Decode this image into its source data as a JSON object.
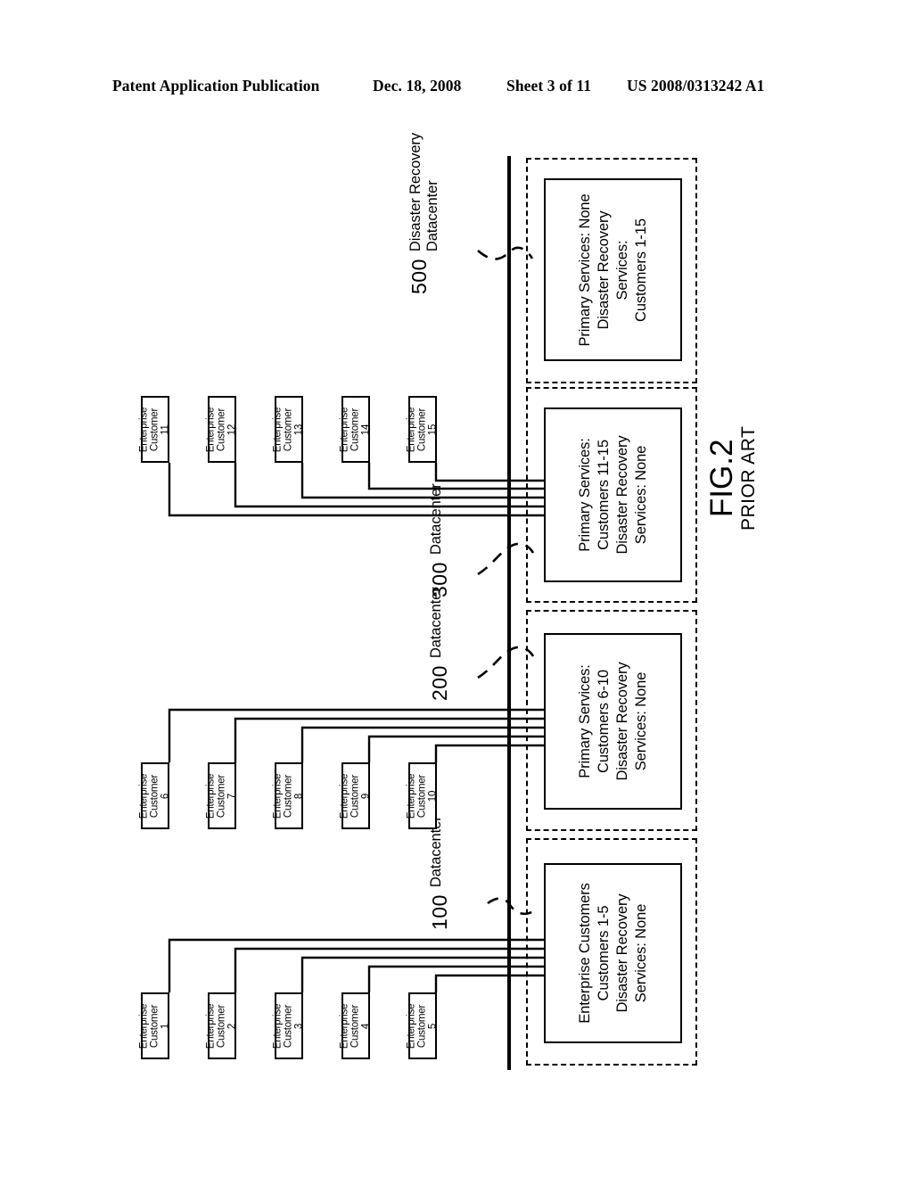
{
  "header": {
    "publication": "Patent Application Publication",
    "date": "Dec. 18, 2008",
    "sheet": "Sheet 3 of 11",
    "number": "US 2008/0313242 A1"
  },
  "figure": {
    "title": "FIG.2",
    "subtitle": "PRIOR ART"
  },
  "customer_label": {
    "line1": "Enterprise",
    "line2": "Customer"
  },
  "customer_groups": [
    {
      "group_id": "customers-11-15",
      "datacenter_ref": "300",
      "customers": [
        {
          "line1": "Enterprise",
          "line2": "Customer",
          "number": "11"
        },
        {
          "line1": "Enterprise",
          "line2": "Customer",
          "number": "12"
        },
        {
          "line1": "Enterprise",
          "line2": "Customer",
          "number": "13"
        },
        {
          "line1": "Enterprise",
          "line2": "Customer",
          "number": "14"
        },
        {
          "line1": "Enterprise",
          "line2": "Customer",
          "number": "15"
        }
      ]
    },
    {
      "group_id": "customers-6-10",
      "datacenter_ref": "200",
      "customers": [
        {
          "line1": "Enterprise",
          "line2": "Customer",
          "number": "6"
        },
        {
          "line1": "Enterprise",
          "line2": "Customer",
          "number": "7"
        },
        {
          "line1": "Enterprise",
          "line2": "Customer",
          "number": "8"
        },
        {
          "line1": "Enterprise",
          "line2": "Customer",
          "number": "9"
        },
        {
          "line1": "Enterprise",
          "line2": "Customer",
          "number": "10"
        }
      ]
    },
    {
      "group_id": "customers-1-5",
      "datacenter_ref": "100",
      "customers": [
        {
          "line1": "Enterprise",
          "line2": "Customer",
          "number": "1"
        },
        {
          "line1": "Enterprise",
          "line2": "Customer",
          "number": "2"
        },
        {
          "line1": "Enterprise",
          "line2": "Customer",
          "number": "3"
        },
        {
          "line1": "Enterprise",
          "line2": "Customer",
          "number": "4"
        },
        {
          "line1": "Enterprise",
          "line2": "Customer",
          "number": "5"
        }
      ]
    }
  ],
  "datacenters": [
    {
      "ref": "500",
      "caption_line1": "Disaster Recovery",
      "caption_line2": "Datacenter",
      "body": [
        "Primary Services: None",
        "Disaster Recovery",
        "Services:",
        "Customers 1-15"
      ]
    },
    {
      "ref": "300",
      "caption_line1": "Datacenter",
      "caption_line2": "",
      "body": [
        "Primary Services:",
        "Customers 11-15",
        "Disaster Recovery",
        "Services: None"
      ]
    },
    {
      "ref": "200",
      "caption_line1": "Datacenter",
      "caption_line2": "",
      "body": [
        "Primary Services:",
        "Customers 6-10",
        "Disaster Recovery",
        "Services: None"
      ]
    },
    {
      "ref": "100",
      "caption_line1": "Datacenter",
      "caption_line2": "",
      "body": [
        "Enterprise Customers",
        "Customers 1-5",
        "Disaster Recovery",
        "Services: None"
      ]
    }
  ],
  "colors": {
    "ink": "#000000",
    "paper": "#ffffff"
  }
}
